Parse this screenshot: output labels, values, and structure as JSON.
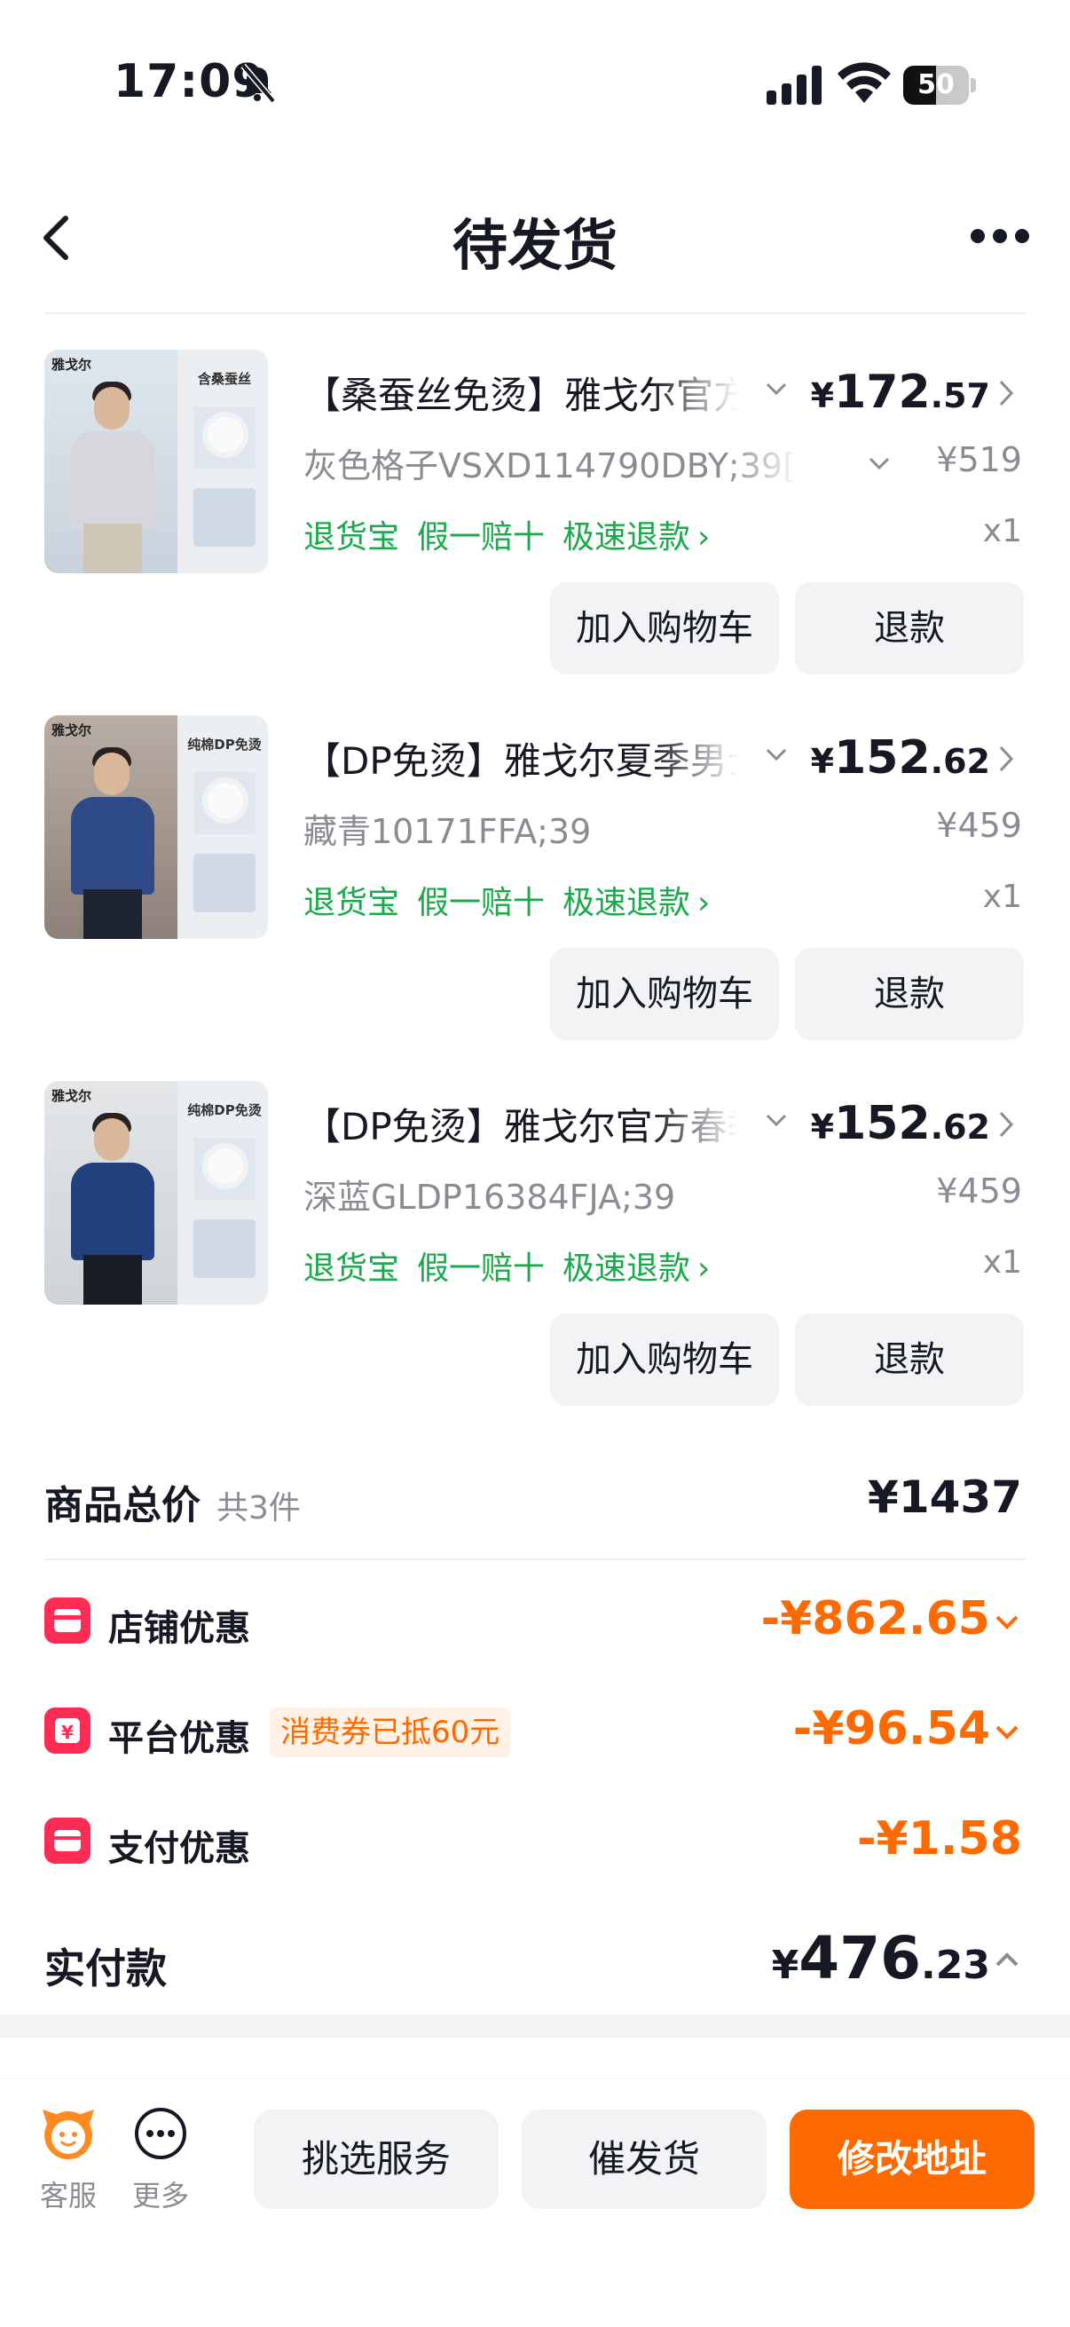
{
  "status_bar": {
    "time": "17:09",
    "battery": "50",
    "battery_level": 0.5
  },
  "nav": {
    "title": "待发货"
  },
  "products": [
    {
      "title": "【桑蚕丝免烫】雅戈尔官方旗舰店男士短袖衬衫",
      "price_int": "172",
      "price_dec": ".57",
      "variant": "灰色格子VSXD114790DBY;39[",
      "original_price": "¥519",
      "badges": [
        "退货宝",
        "假一赔十",
        "极速退款"
      ],
      "quantity": "x1",
      "thumb_brand": "雅戈尔",
      "thumb_tag": "含桑蚕丝",
      "buttons": {
        "cart": "加入购物车",
        "refund": "退款"
      }
    },
    {
      "title": "【DP免烫】雅戈尔夏季男士短袖衬衫",
      "price_int": "152",
      "price_dec": ".62",
      "variant": "藏青10171FFA;39",
      "original_price": "¥459",
      "badges": [
        "退货宝",
        "假一赔十",
        "极速退款"
      ],
      "quantity": "x1",
      "thumb_brand": "雅戈尔",
      "thumb_tag": "纯棉DP免烫",
      "buttons": {
        "cart": "加入购物车",
        "refund": "退款"
      }
    },
    {
      "title": "【DP免烫】雅戈尔官方春季男士长袖衬衫",
      "price_int": "152",
      "price_dec": ".62",
      "variant": "深蓝GLDP16384FJA;39",
      "original_price": "¥459",
      "badges": [
        "退货宝",
        "假一赔十",
        "极速退款"
      ],
      "quantity": "x1",
      "thumb_brand": "雅戈尔",
      "thumb_tag": "纯棉DP免烫",
      "buttons": {
        "cart": "加入购物车",
        "refund": "退款"
      }
    }
  ],
  "summary": {
    "total_label": "商品总价",
    "total_count": "共3件",
    "total_value": "¥1437",
    "discounts": [
      {
        "label": "店铺优惠",
        "value": "-¥862.65",
        "tag": ""
      },
      {
        "label": "平台优惠",
        "value": "-¥96.54",
        "tag": "消费券已抵60元"
      },
      {
        "label": "支付优惠",
        "value": "-¥1.58",
        "tag": ""
      }
    ],
    "paid_label": "实付款",
    "paid_int": "476",
    "paid_dec": ".23"
  },
  "bottom_bar": {
    "service_label": "客服",
    "more_label": "更多",
    "select_service": "挑选服务",
    "urge_shipping": "催发货",
    "modify_address": "修改地址"
  },
  "colors": {
    "accent": "#ff6a00",
    "green": "#1aa94b",
    "discount_icon": "#fe2c55"
  }
}
